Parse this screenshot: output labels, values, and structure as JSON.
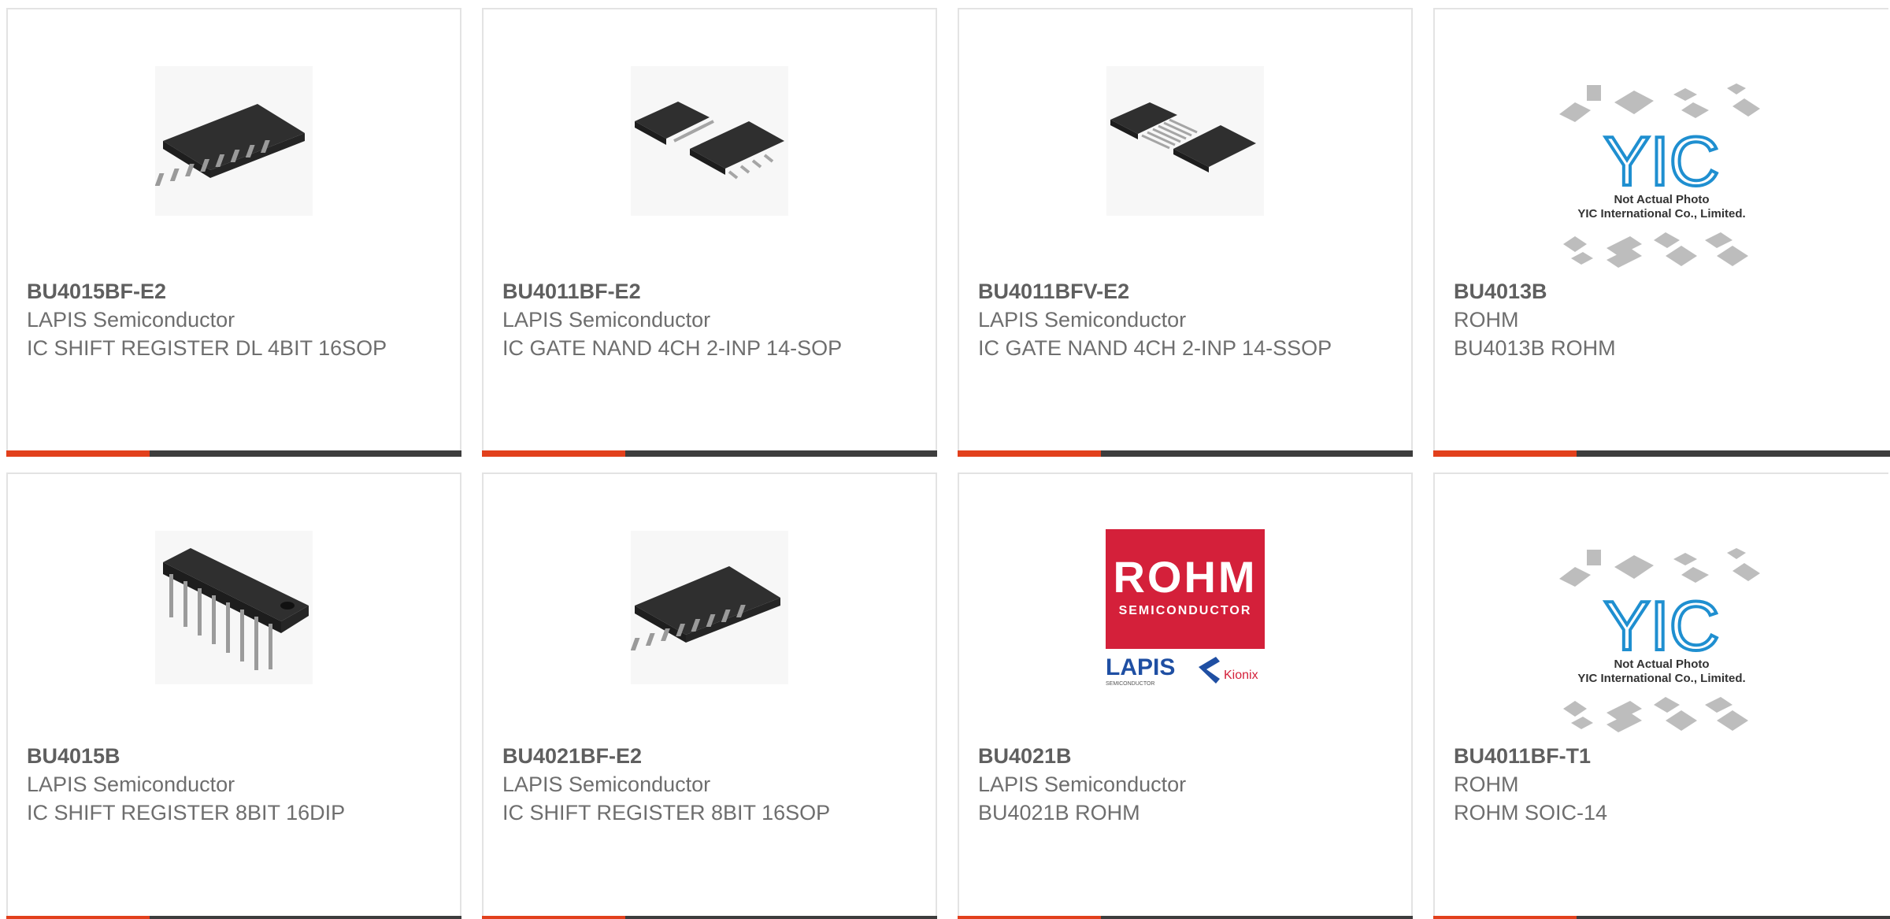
{
  "colors": {
    "accent": "#e2401c",
    "bar": "#3d3d3d",
    "border": "#e3e3e3",
    "text": "#6b6b6b"
  },
  "cards": [
    {
      "part": "BU4015BF-E2",
      "mfr": "LAPIS Semiconductor",
      "desc": "IC SHIFT REGISTER DL 4BIT 16SOP",
      "image": "sop16-chip-icon"
    },
    {
      "part": "BU4011BF-E2",
      "mfr": "LAPIS Semiconductor",
      "desc": "IC GATE NAND 4CH 2-INP 14-SOP",
      "image": "sop14-pair-icon"
    },
    {
      "part": "BU4011BFV-E2",
      "mfr": "LAPIS Semiconductor",
      "desc": "IC GATE NAND 4CH 2-INP 14-SSOP",
      "image": "ssop14-pair-icon"
    },
    {
      "part": "BU4013B",
      "mfr": "ROHM",
      "desc": "BU4013B ROHM",
      "image": "yic-not-actual-photo-icon",
      "caption1": "Not Actual Photo",
      "caption2": "YIC International Co., Limited."
    },
    {
      "part": "BU4015B",
      "mfr": "LAPIS Semiconductor",
      "desc": "IC SHIFT REGISTER 8BIT 16DIP",
      "image": "dip16-chip-icon"
    },
    {
      "part": "BU4021BF-E2",
      "mfr": "LAPIS Semiconductor",
      "desc": "IC SHIFT REGISTER 8BIT 16SOP",
      "image": "sop16-chip-icon"
    },
    {
      "part": "BU4021B",
      "mfr": "LAPIS Semiconductor",
      "desc": "BU4021B ROHM",
      "image": "rohm-lapis-kionix-logo",
      "logo_main": "ROHM",
      "logo_sub": "SEMICONDUCTOR",
      "logo_lapis": "LAPIS",
      "logo_lapis_sub": "SEMICONDUCTOR",
      "logo_kionix": "Kionix"
    },
    {
      "part": "BU4011BF-T1",
      "mfr": "ROHM",
      "desc": "ROHM SOIC-14",
      "image": "yic-not-actual-photo-icon",
      "caption1": "Not Actual Photo",
      "caption2": "YIC International Co., Limited."
    }
  ]
}
